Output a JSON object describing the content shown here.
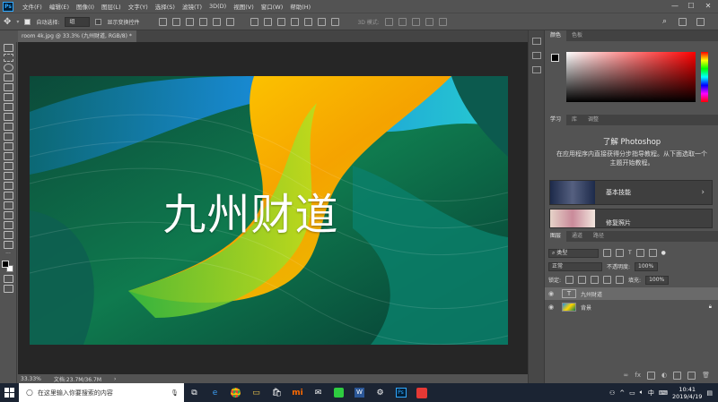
{
  "menu": {
    "items": [
      "文件(F)",
      "编辑(E)",
      "图像(I)",
      "图层(L)",
      "文字(Y)",
      "选择(S)",
      "滤镜(T)",
      "3D(D)",
      "视图(V)",
      "窗口(W)",
      "帮助(H)"
    ]
  },
  "window_controls": {
    "minimize": "—",
    "maximize": "☐",
    "close": "✕"
  },
  "options_bar": {
    "auto_select_label": "自动选择:",
    "auto_select_value": "组",
    "show_transform_label": "显示变换控件",
    "mode_3d_label": "3D 模式:"
  },
  "document": {
    "tab_title": "room 4k.jpg @ 33.3% (九州财道, RGB/8) *",
    "artwork_text": "九州财道",
    "zoom": "33.33%",
    "file_info": "文档:23.7M/36.7M"
  },
  "color_panel": {
    "tabs": [
      "颜色",
      "色板"
    ]
  },
  "learn_panel": {
    "tabs": [
      "学习",
      "库",
      "调整"
    ],
    "title": "了解 Photoshop",
    "description": "在应用程序内直接获得分步指导教程。从下面选取一个主题开始教程。",
    "cards": [
      {
        "label": "基本技能"
      },
      {
        "label": "修复照片"
      }
    ]
  },
  "layers_panel": {
    "tabs": [
      "图层",
      "通道",
      "路径"
    ],
    "filter_kind": "类型",
    "blend_mode": "正常",
    "opacity_label": "不透明度:",
    "opacity_value": "100%",
    "lock_label": "锁定:",
    "fill_label": "填充:",
    "fill_value": "100%",
    "layers": [
      {
        "name": "九州财道",
        "type": "text"
      },
      {
        "name": "背景",
        "type": "image",
        "locked": true
      }
    ],
    "footer_icons": [
      "link-icon",
      "fx-icon",
      "mask-icon",
      "adjustment-icon",
      "group-icon",
      "new-layer-icon",
      "trash-icon"
    ]
  },
  "taskbar": {
    "search_placeholder": "在这里输入你要搜索的内容",
    "apps": [
      "task-view",
      "edge",
      "chrome",
      "explorer",
      "store",
      "xiaomi",
      "mail",
      "green-app",
      "word",
      "settings",
      "photoshop",
      "red-app"
    ],
    "tray_lang": "中",
    "time": "10:41",
    "date": "2019/4/19"
  },
  "colors": {
    "accent": "#31a8ff",
    "panel": "#535353",
    "canvas_bg": "#262626",
    "taskbar": "#1b2433"
  }
}
